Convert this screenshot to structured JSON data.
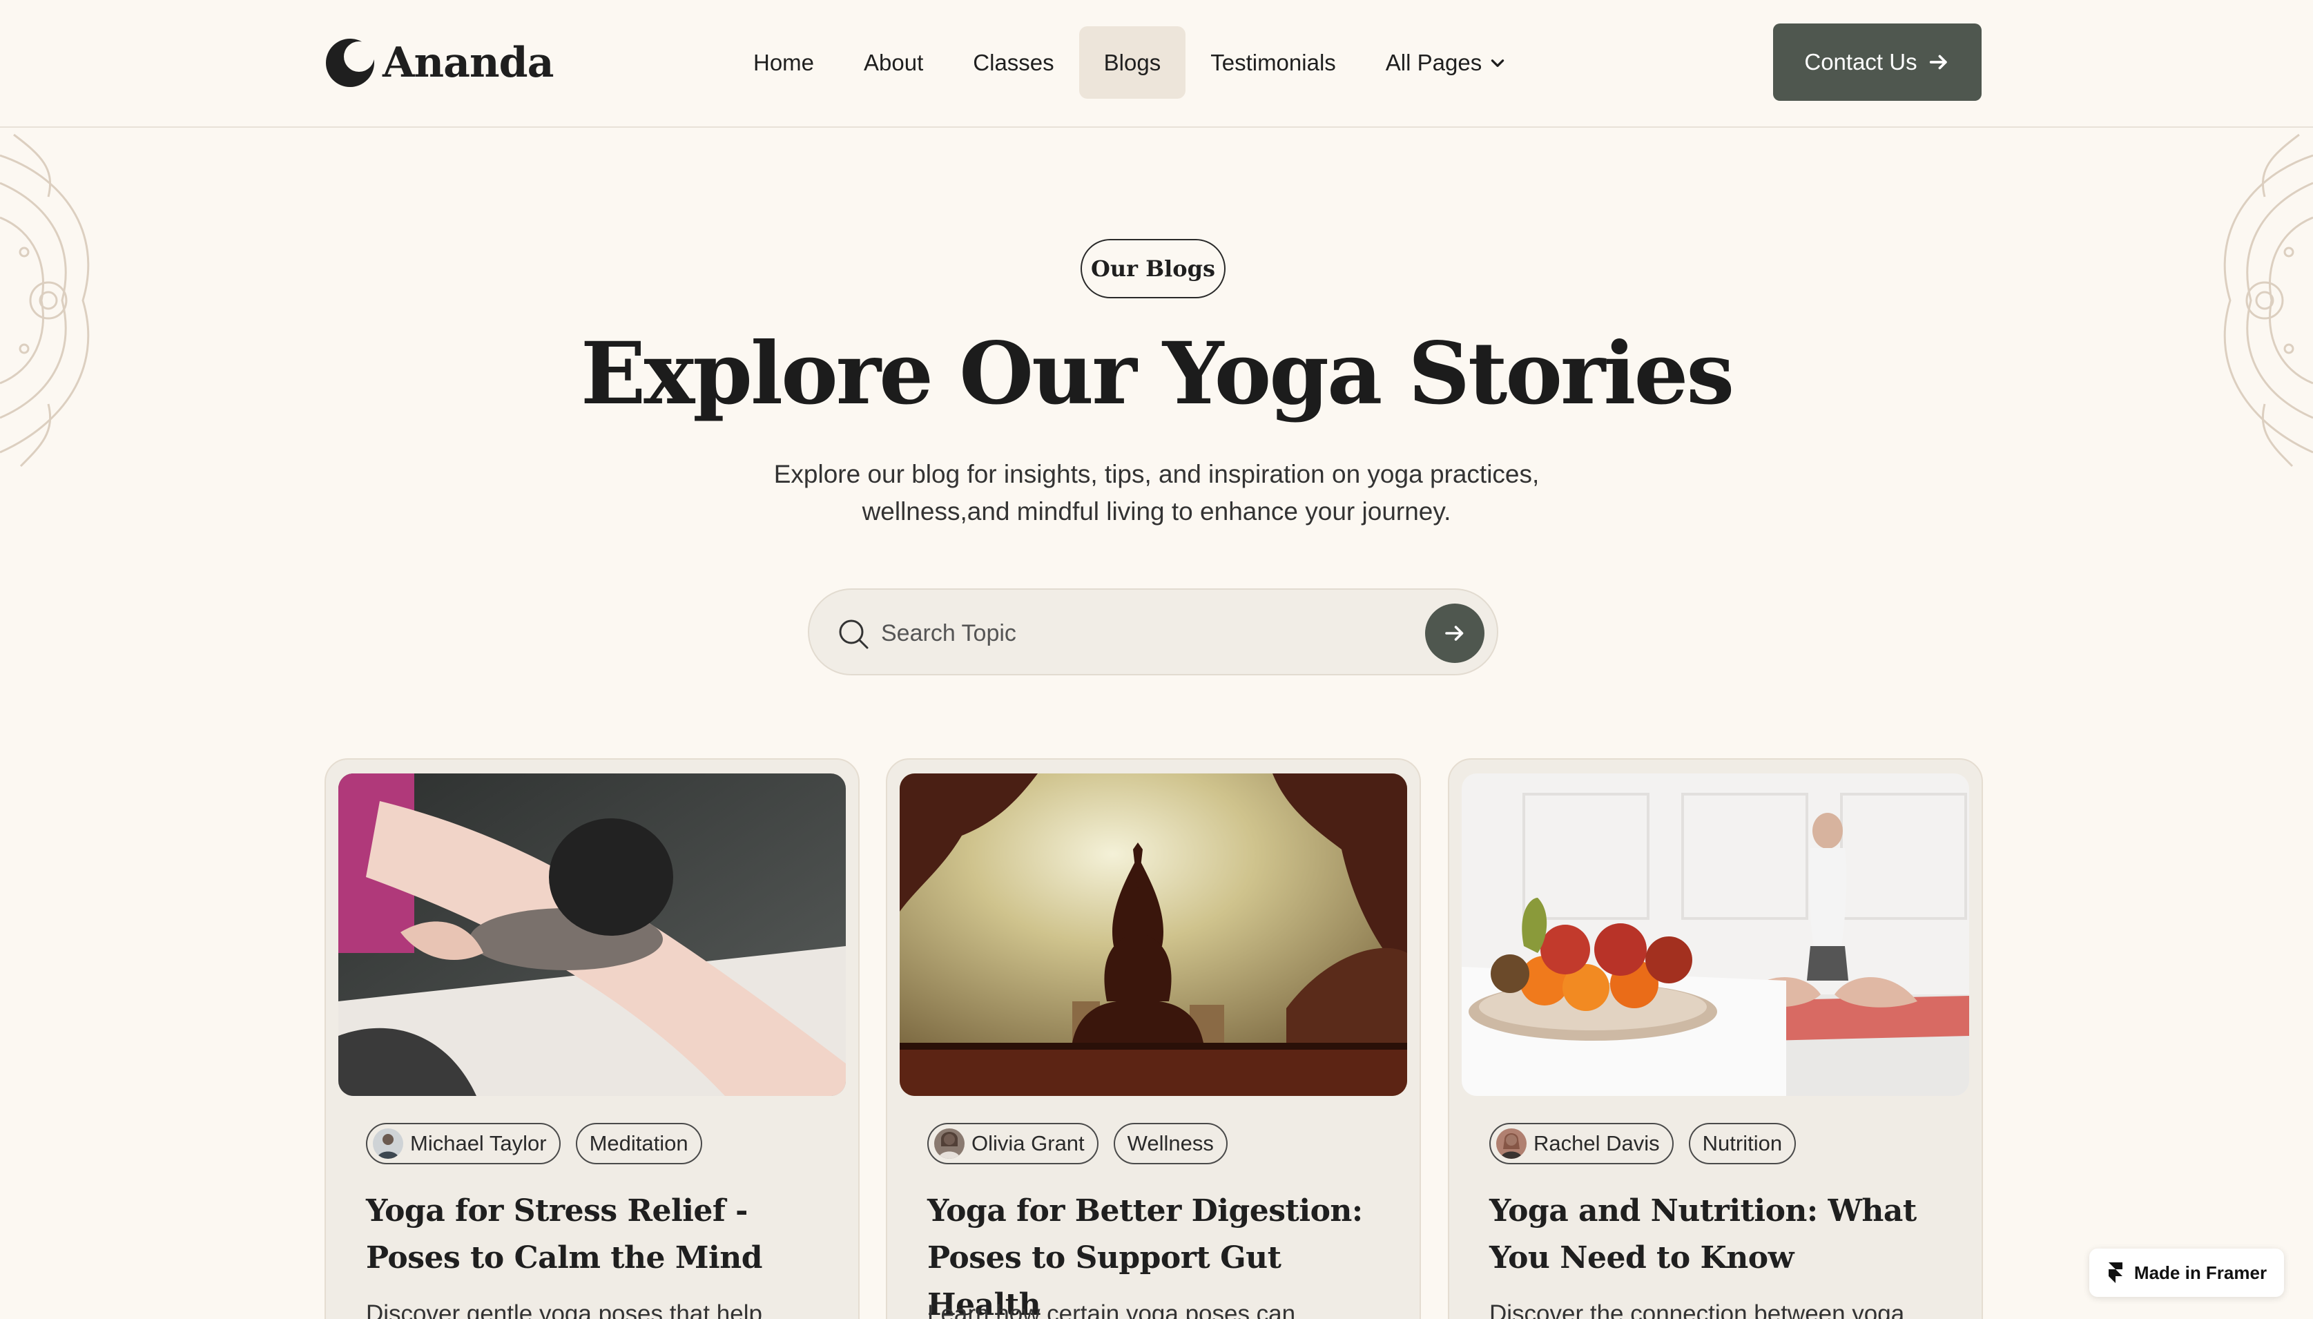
{
  "brand": {
    "name": "Ananda"
  },
  "nav": {
    "items": [
      {
        "label": "Home",
        "active": false
      },
      {
        "label": "About",
        "active": false
      },
      {
        "label": "Classes",
        "active": false
      },
      {
        "label": "Blogs",
        "active": true
      },
      {
        "label": "Testimonials",
        "active": false
      },
      {
        "label": "All Pages",
        "active": false,
        "icon": "chevron-down-icon"
      }
    ],
    "cta_label": "Contact Us",
    "cta_icon": "arrow-right-icon"
  },
  "hero": {
    "tag": "Our Blogs",
    "title": "Explore Our Yoga Stories",
    "subtitle_line1": "Explore our blog for insights, tips, and inspiration on yoga practices,",
    "subtitle_line2": "wellness,and mindful living to enhance your journey."
  },
  "search": {
    "placeholder": "Search Topic",
    "value": "",
    "icon": "search-icon",
    "submit_icon": "arrow-right-icon"
  },
  "posts": [
    {
      "author": "Michael Taylor",
      "category": "Meditation",
      "title": "Yoga for Stress Relief - Poses to Calm the Mind",
      "excerpt": "Discover gentle yoga poses that help"
    },
    {
      "author": "Olivia Grant",
      "category": "Wellness",
      "title": "Yoga for Better Digestion: Poses to Support Gut Health",
      "excerpt": "Learn how certain yoga poses can"
    },
    {
      "author": "Rachel Davis",
      "category": "Nutrition",
      "title": "Yoga and Nutrition: What You Need to Know",
      "excerpt": "Discover the connection between yoga"
    }
  ],
  "badge": {
    "label": "Made in Framer"
  },
  "colors": {
    "background": "#fcf8f2",
    "accent": "#4f574f",
    "card": "#f0ece5",
    "active_nav": "#ede5da"
  }
}
